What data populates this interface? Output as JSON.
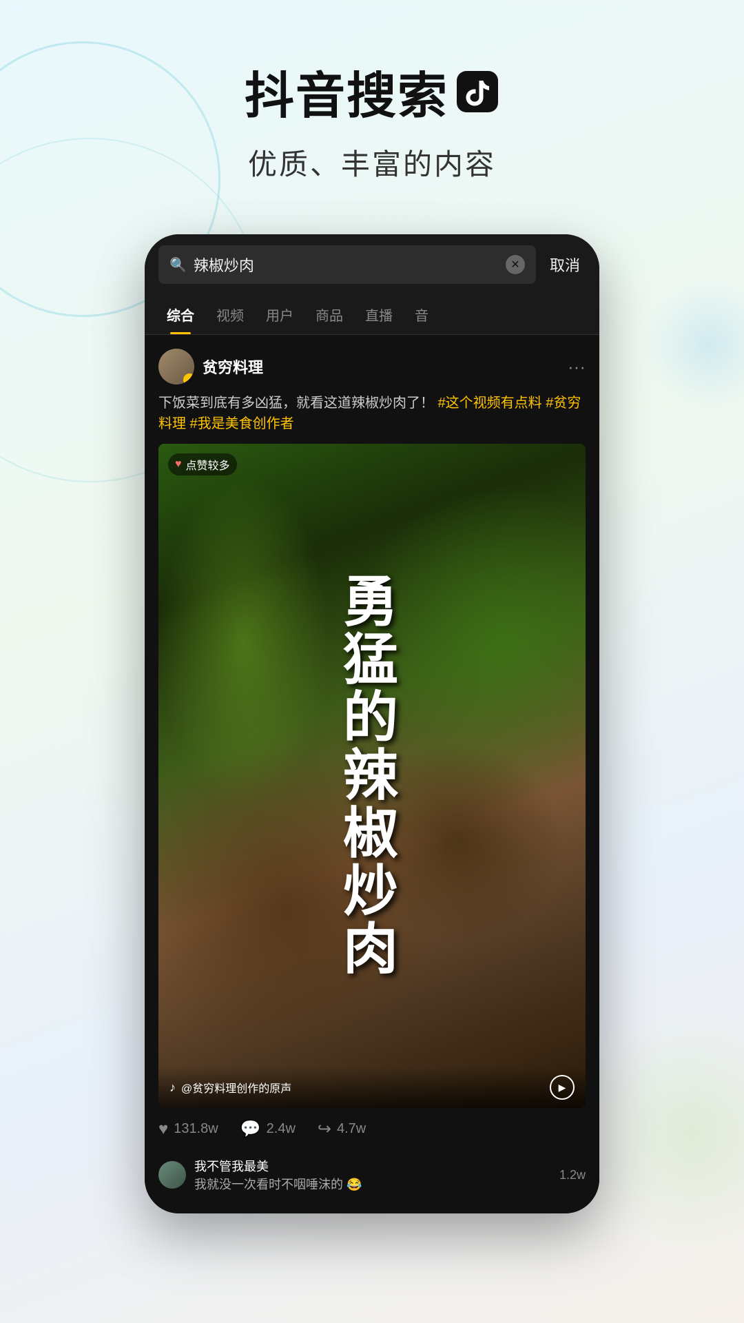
{
  "background": {
    "gradient": "linear-gradient(160deg, #e8f8fc, #f0f9f0, #e8f0fa, #f5f0e8)"
  },
  "header": {
    "title": "抖音搜索",
    "subtitle": "优质、丰富的内容",
    "tiktok_icon": "♪"
  },
  "phone": {
    "searchBar": {
      "placeholder": "辣椒炒肉",
      "cancelLabel": "取消"
    },
    "tabs": [
      {
        "label": "综合",
        "active": true
      },
      {
        "label": "视频",
        "active": false
      },
      {
        "label": "用户",
        "active": false
      },
      {
        "label": "商品",
        "active": false
      },
      {
        "label": "直播",
        "active": false
      },
      {
        "label": "音",
        "active": false
      }
    ],
    "post": {
      "authorName": "贫穷料理",
      "description": "下饭菜到底有多凶猛，就看这道辣椒炒肉了！",
      "hashtags": [
        "#这个视频有点料",
        "#贫穷料理",
        "#我是美食创作者"
      ],
      "videoBadge": "点赞较多",
      "videoText": "勇猛的辣椒炒肉",
      "videoSource": "@贫穷料理创作的原声",
      "engagement": {
        "likes": "131.8w",
        "comments": "2.4w",
        "shares": "4.7w"
      },
      "commentPreview": {
        "userName": "我不管我最美",
        "text": "我就没一次看时不咽唾沫的 😂",
        "count": "1.2w"
      }
    }
  }
}
